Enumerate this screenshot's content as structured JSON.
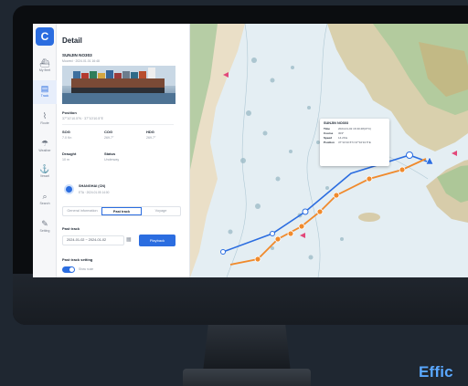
{
  "nav": {
    "logo": "C",
    "items": [
      {
        "label": "My fleet",
        "icon": "ship-icon"
      },
      {
        "label": "Track",
        "icon": "track-icon"
      },
      {
        "label": "Route",
        "icon": "route-icon"
      },
      {
        "label": "Weather",
        "icon": "weather-icon"
      },
      {
        "label": "Vessel",
        "icon": "vessel-icon"
      },
      {
        "label": "Search",
        "icon": "search-icon"
      },
      {
        "label": "Setting",
        "icon": "wrench-icon"
      }
    ]
  },
  "detail": {
    "title": "Detail",
    "ship_name": "SUNJIN NO303",
    "ship_sub": "Moored · 2024.01.01 16:48",
    "position_label": "Position",
    "position_value": "37°10'10.5\"N · 37°10'10.5\"E",
    "sog_label": "SOG",
    "sog_value": "7.0 Kn",
    "cog_label": "COG",
    "cog_value": "269.7°",
    "hdg_label": "HDG",
    "hdg_value": "269.7°",
    "draught_label": "Draught",
    "draught_value": "10 m",
    "status_label": "Status",
    "status_value": "Underway",
    "port_name": "SHANGHAI (CN)",
    "port_sub": "ETA · 2024.01.05 14:00",
    "tabs": [
      "General information",
      "Past track",
      "Voyage"
    ],
    "active_tab": 1,
    "past_track_label": "Past track",
    "date_range": "2024-01-02 ~ 2024-01-02",
    "playback_label": "Playback",
    "setting_label": "Past track setting",
    "show_route_label": "Show route"
  },
  "popup": {
    "title": "SUNJIN NO303",
    "rows": [
      {
        "k": "Time",
        "v": "2024-01-02 16:30:48(UTC)"
      },
      {
        "k": "Course",
        "v": "303°"
      },
      {
        "k": "Speed",
        "v": "14.2Kts"
      },
      {
        "k": "Position",
        "v": "37°10'10.5\"N   37°10'10.5\"E"
      }
    ]
  },
  "footer_text": "Effic",
  "colors": {
    "accent": "#2b6de0",
    "track_orange": "#f08a2c",
    "route_blue": "#2b6de0"
  }
}
